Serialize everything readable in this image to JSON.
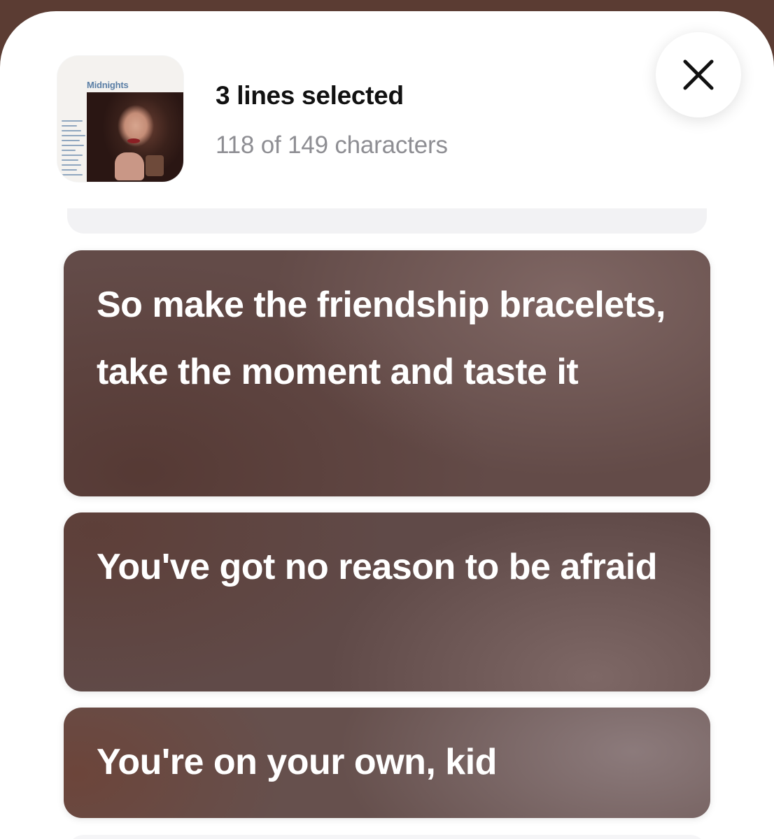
{
  "header": {
    "album_title": "Midnights",
    "title": "3 lines selected",
    "subtitle": "118 of 149 characters"
  },
  "lyrics": [
    {
      "text": "So make the friendship bracelets, take the moment and taste it"
    },
    {
      "text": "You've got no reason to be afraid"
    },
    {
      "text": "You're on your own, kid"
    }
  ],
  "icons": {
    "close": "close-icon"
  },
  "colors": {
    "card_base": "#634b48",
    "background": "#5b3c33"
  }
}
